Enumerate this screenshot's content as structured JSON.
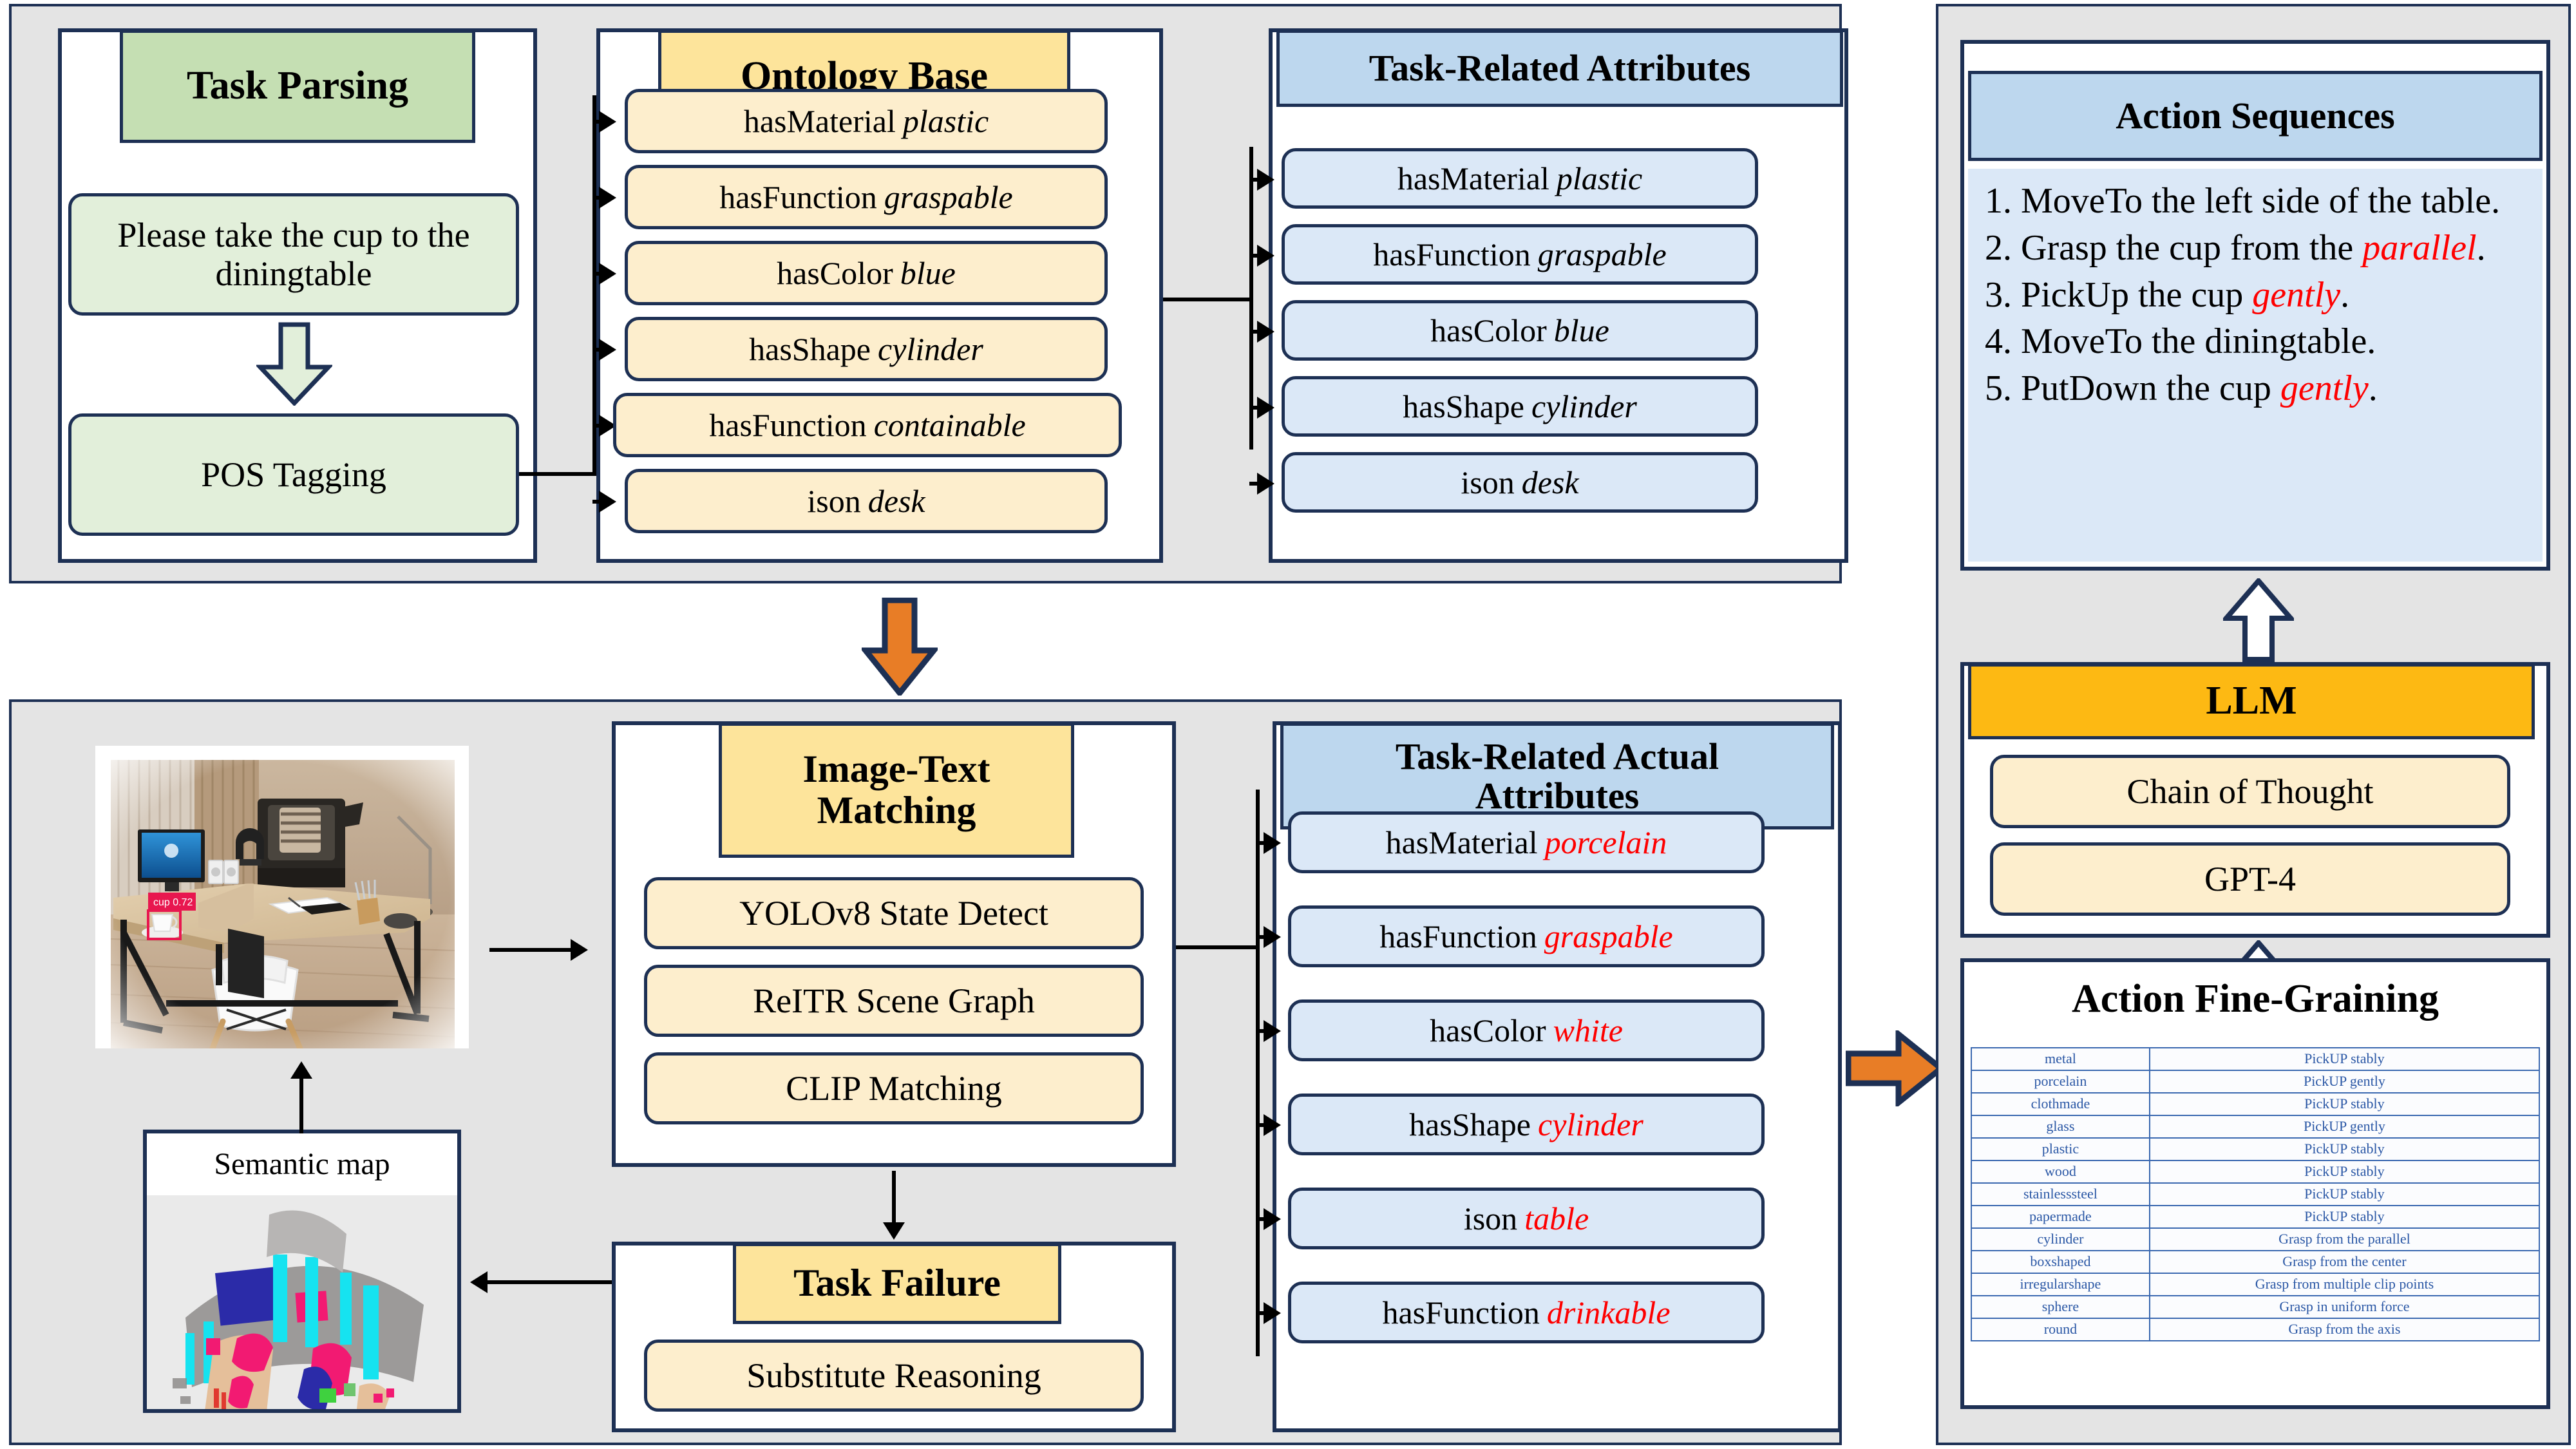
{
  "top_panel": {
    "task_parsing": {
      "header": "Task Parsing",
      "instruction": "Please take the cup to the diningtable",
      "pos_tagging": "POS Tagging"
    },
    "ontology_base": {
      "header": "Ontology Base",
      "items": [
        {
          "prop": "hasMaterial",
          "val": "plastic"
        },
        {
          "prop": "hasFunction",
          "val": "graspable"
        },
        {
          "prop": "hasColor",
          "val": "blue"
        },
        {
          "prop": "hasShape",
          "val": "cylinder"
        },
        {
          "prop": "hasFunction",
          "val": "containable"
        },
        {
          "prop": "ison",
          "val": "desk"
        }
      ]
    },
    "task_related_attributes": {
      "header": "Task-Related Attributes",
      "items": [
        {
          "prop": "hasMaterial",
          "val": "plastic"
        },
        {
          "prop": "hasFunction",
          "val": "graspable"
        },
        {
          "prop": "hasColor",
          "val": "blue"
        },
        {
          "prop": "hasShape",
          "val": "cylinder"
        },
        {
          "prop": "ison",
          "val": "desk"
        }
      ]
    }
  },
  "bottom_panel": {
    "scene_photo": {
      "detection_label": "cup  0.72"
    },
    "semantic_map": {
      "title": "Semantic map"
    },
    "image_text_matching": {
      "header_line1": "Image-Text",
      "header_line2": "Matching",
      "items": [
        "YOLOv8 State Detect",
        "ReITR Scene Graph",
        "CLIP Matching"
      ]
    },
    "task_failure": {
      "header": "Task Failure",
      "items": [
        "Substitute Reasoning"
      ]
    },
    "task_related_actual_attributes": {
      "header_line1": "Task-Related Actual",
      "header_line2": "Attributes",
      "items": [
        {
          "prop": "hasMaterial",
          "val": "porcelain"
        },
        {
          "prop": "hasFunction",
          "val": "graspable"
        },
        {
          "prop": "hasColor",
          "val": "white"
        },
        {
          "prop": "hasShape",
          "val": "cylinder"
        },
        {
          "prop": "ison",
          "val": "table"
        },
        {
          "prop": "hasFunction",
          "val": "drinkable"
        }
      ]
    }
  },
  "right_panel": {
    "action_sequences": {
      "header": "Action Sequences",
      "steps": [
        {
          "n": "1.",
          "text": "MoveTo the left side of the table.",
          "em": "",
          "tail": ""
        },
        {
          "n": "2.",
          "text": "Grasp the cup from the ",
          "em": "parallel",
          "tail": "."
        },
        {
          "n": "3.",
          "text": "PickUp the cup ",
          "em": "gently",
          "tail": "."
        },
        {
          "n": "4.",
          "text": "MoveTo the diningtable.",
          "em": "",
          "tail": ""
        },
        {
          "n": "5.",
          "text": "PutDown the cup ",
          "em": "gently",
          "tail": "."
        }
      ]
    },
    "llm": {
      "header": "LLM",
      "items": [
        "Chain of Thought",
        "GPT-4"
      ]
    },
    "action_fine_graining": {
      "header": "Action Fine-Graining",
      "rows": [
        [
          "metal",
          "PickUP stably"
        ],
        [
          "porcelain",
          "PickUP gently"
        ],
        [
          "clothmade",
          "PickUP stably"
        ],
        [
          "glass",
          "PickUP gently"
        ],
        [
          "plastic",
          "PickUP stably"
        ],
        [
          "wood",
          "PickUP stably"
        ],
        [
          "stainlesssteel",
          "PickUP stably"
        ],
        [
          "papermade",
          "PickUP stably"
        ],
        [
          "cylinder",
          "Grasp from the parallel"
        ],
        [
          "boxshaped",
          "Grasp from the center"
        ],
        [
          "irregularshape",
          "Grasp from multiple clip points"
        ],
        [
          "sphere",
          "Grasp in uniform force"
        ],
        [
          "round",
          "Grasp from the axis"
        ]
      ]
    }
  },
  "colors": {
    "navy": "#1d3054",
    "orange_arrow": "#e87d26",
    "llm_orange": "#fdb913",
    "header_yellow": "#fde49b",
    "header_blue": "#bdd7ee",
    "header_green": "#c5dfb3",
    "pill_yellow": "#fdeecd",
    "pill_blue": "#dbe8f7",
    "pill_green": "#e2efda",
    "emphasis_red": "#fe0000",
    "table_blue": "#2a57a5",
    "panel_grey": "#e4e4e4"
  }
}
